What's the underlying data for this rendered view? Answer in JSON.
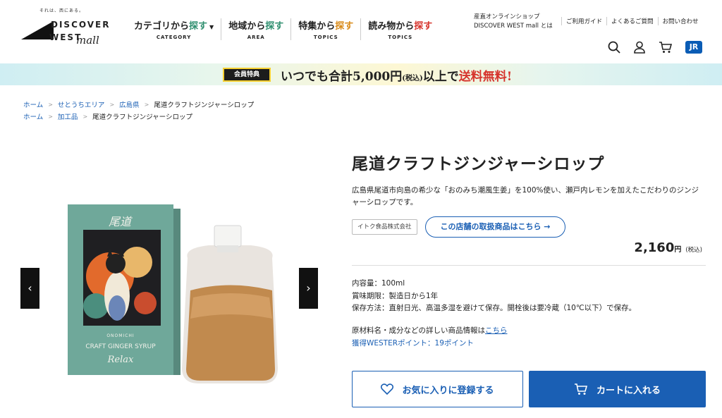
{
  "header": {
    "logo_tagline": "それは、西にある。",
    "logo_word1": "DISCOVER",
    "logo_word2": "WEST",
    "logo_mall": "mall",
    "nav": [
      {
        "pre": "カテゴリから",
        "accent": "探す",
        "sub": "CATEGORY",
        "accent_color": "#2f8f6f"
      },
      {
        "pre": "地域から",
        "accent": "探す",
        "sub": "AREA",
        "accent_color": "#2f8f6f"
      },
      {
        "pre": "特集から",
        "accent": "探す",
        "sub": "TOPICS",
        "accent_color": "#d88a18"
      },
      {
        "pre": "読み物から",
        "accent": "探す",
        "sub": "TOPICS",
        "accent_color": "#d6342c"
      }
    ],
    "shop_info_line1": "産直オンラインショップ",
    "shop_info_line2": "DISCOVER WEST mall とは",
    "links": [
      "ご利用ガイド",
      "よくあるご質問",
      "お問い合わせ"
    ],
    "jr_logo": "JR"
  },
  "banner": {
    "badge": "会員特典",
    "text_a": "いつでも合計5,000円",
    "text_small": "(税込)",
    "text_b": "以上で",
    "text_red": "送料無料!"
  },
  "breadcrumbs": [
    [
      "ホーム",
      "せとうちエリア",
      "広島県",
      "尾道クラフトジンジャーシロップ"
    ],
    [
      "ホーム",
      "加工品",
      "尾道クラフトジンジャーシロップ"
    ]
  ],
  "product": {
    "title": "尾道クラフトジンジャーシロップ",
    "description": "広島県尾道市向島の希少な「おのみち潮風生姜」を100%使い、瀬戸内レモンを加えたこだわりのジンジャーシロップです。",
    "maker": "イトク食品株式会社",
    "shop_button": "この店舗の取扱商品はこちら →",
    "price": "2,160",
    "price_yen": "円",
    "price_tax": "(税込)",
    "specs": [
      "内容量：100ml",
      "賞味期限：製造日から1年",
      "保存方法：直射日光、高温多湿を避けて保存。開栓後は要冷蔵（10℃以下）で保存。"
    ],
    "more_text": "原材料名・成分などの詳しい商品情報は",
    "more_link": "こちら",
    "points": "獲得WESTERポイント：19ポイント",
    "fav_button": "お気に入りに登録する",
    "cart_button": "カートに入れる",
    "box_script": "尾道",
    "box_sub": "ONOMICHI",
    "box_name": "CRAFT GINGER SYRUP",
    "box_relax": "Relax"
  },
  "colors": {
    "accent": "#1a5fb4",
    "red": "#d6342c",
    "box": "#6fa89a"
  }
}
